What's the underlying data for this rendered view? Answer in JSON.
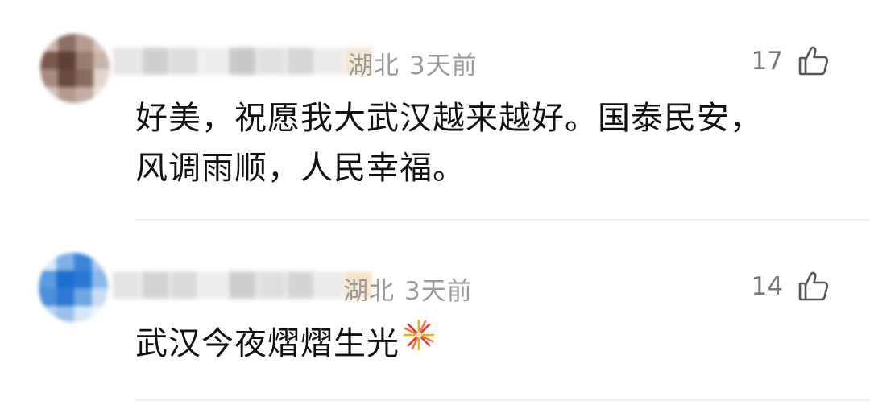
{
  "comments": [
    {
      "location": "湖北",
      "time": "3天前",
      "likes": "17",
      "lines": [
        "好美，祝愿我大武汉越来越好。国泰民安，",
        "风调雨顺，人民幸福。"
      ],
      "avatar_colors": [
        "#c9b7ae",
        "#8e6f63",
        "#b89c90",
        "#d8c8c0",
        "#7a5a50",
        "#5e4036",
        "#9b7d70",
        "#c7b3aa",
        "#a58a7f",
        "#6b4b40",
        "#8a6b5f",
        "#e2d6d0",
        "#d4c2ba",
        "#b39a8f",
        "#c3aea5",
        "#ece4df"
      ],
      "name_blur_colors": [
        "#e6e6e6",
        "#cfcfcf",
        "#dcdcdc",
        "#eeeeee",
        "#c8c8c8",
        "#e0e0e0",
        "#d6d6d6",
        "#ebebeb",
        "#f3e6d2"
      ]
    },
    {
      "location": "湖北",
      "time": "3天前",
      "likes": "14",
      "lines": [
        "武汉今夜熠熠生光"
      ],
      "avatar_colors": [
        "#d9e8f7",
        "#7fb0e6",
        "#3c86d8",
        "#a9c9ee",
        "#5b9be0",
        "#1e6fd0",
        "#2a78d6",
        "#8ab8ea",
        "#4d8fdb",
        "#2c7ad6",
        "#6ea5e4",
        "#c8dcf2",
        "#b7d2f0",
        "#9bc0ec",
        "#d7e6f6",
        "#eef4fb"
      ],
      "name_blur_colors": [
        "#e3e3e3",
        "#d2d2d2",
        "#dadada",
        "#ededed",
        "#cccccc",
        "#dedede",
        "#d4d4d4",
        "#eaeaea",
        "#f4e4c8"
      ]
    }
  ],
  "icons": {
    "like": "thumbs-up-icon",
    "emoji": "fireworks-emoji"
  }
}
